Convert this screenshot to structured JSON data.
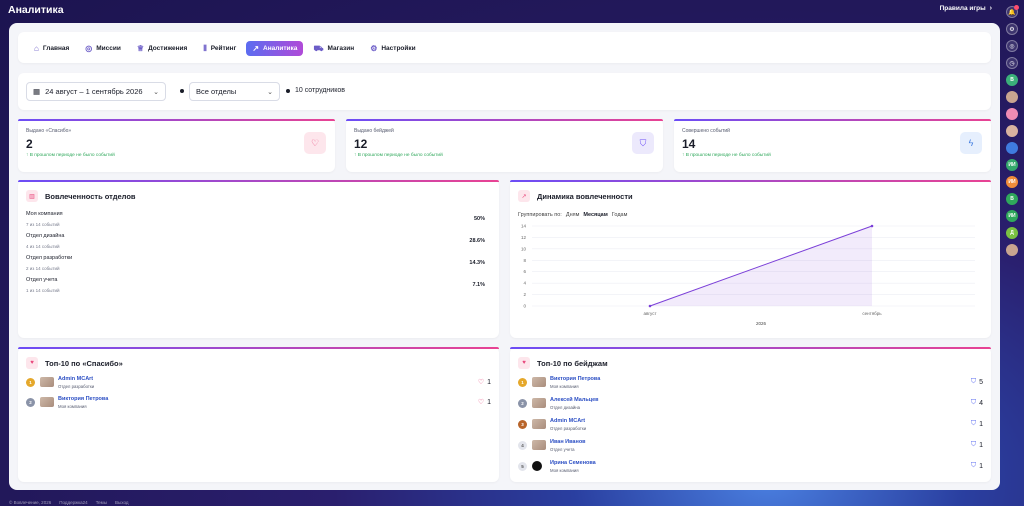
{
  "app": {
    "title": "Аналитика",
    "rules_link": "Правила игры"
  },
  "nav": {
    "tabs": [
      {
        "label": "Главная",
        "icon": "home-icon"
      },
      {
        "label": "Миссии",
        "icon": "target-icon"
      },
      {
        "label": "Достижения",
        "icon": "trophy-icon"
      },
      {
        "label": "Рейтинг",
        "icon": "podium-icon"
      },
      {
        "label": "Аналитика",
        "icon": "chart-icon",
        "active": true
      },
      {
        "label": "Магазин",
        "icon": "cart-icon"
      },
      {
        "label": "Настройки",
        "icon": "gear-icon"
      }
    ]
  },
  "filters": {
    "date_range": "24 август – 1 сентябрь 2026",
    "department": "Все отделы",
    "employees": "10 сотрудников"
  },
  "stats": [
    {
      "label": "Выдано «Спасибо»",
      "value": "2",
      "note": "В прошлом периоде не было событий",
      "icon": "heart-icon",
      "bg": "#fde6ec",
      "fg": "#e8457a"
    },
    {
      "label": "Выдано бейджей",
      "value": "12",
      "note": "В прошлом периоде не было событий",
      "icon": "shield-icon",
      "bg": "#ece9fc",
      "fg": "#6c4df6"
    },
    {
      "label": "Совершено событий",
      "value": "14",
      "note": "В прошлом периоде не было событий",
      "icon": "bolt-icon",
      "bg": "#e6effd",
      "fg": "#3f7be0"
    }
  ],
  "engagement": {
    "title": "Вовлеченность отделов",
    "rows": [
      {
        "name": "Моя компания",
        "sub": "7 из 14 событий",
        "pct": "50%"
      },
      {
        "name": "Отдел дизайна",
        "sub": "4 из 14 событий",
        "pct": "28.6%"
      },
      {
        "name": "Отдел разработки",
        "sub": "2 из 14 событий",
        "pct": "14.3%"
      },
      {
        "name": "Отдел учета",
        "sub": "1 из 14 событий",
        "pct": "7.1%"
      }
    ]
  },
  "dynamics": {
    "title": "Динамика вовлеченности",
    "group_label": "Группировать по:",
    "group_options": [
      "Дням",
      "Месяцам",
      "Годам"
    ],
    "active_option": "Месяцам"
  },
  "chart_data": {
    "type": "area",
    "categories": [
      "август",
      "сентябрь"
    ],
    "values": [
      0,
      14
    ],
    "xlabel": "2026",
    "ylabel": "",
    "ylim": [
      0,
      14
    ],
    "yticks": [
      0,
      2,
      4,
      6,
      8,
      10,
      12,
      14
    ],
    "grid": true,
    "color": "#7b3fd8"
  },
  "top_thanks": {
    "title": "Топ-10 по «Спасибо»",
    "rows": [
      {
        "rank": "1",
        "name": "Admin MCArt",
        "dept": "Отдел разработки",
        "count": "1",
        "rank_color": "#e5a82b"
      },
      {
        "rank": "2",
        "name": "Виктория Петрова",
        "dept": "Моя компания",
        "count": "1",
        "rank_color": "#8a93a8"
      }
    ]
  },
  "top_badges": {
    "title": "Топ-10 по бейджам",
    "rows": [
      {
        "rank": "1",
        "name": "Виктория Петрова",
        "dept": "Моя компания",
        "count": "5",
        "rank_color": "#e5a82b"
      },
      {
        "rank": "2",
        "name": "Алексей Мальцев",
        "dept": "Отдел дизайна",
        "count": "4",
        "rank_color": "#8a93a8"
      },
      {
        "rank": "3",
        "name": "Admin MCArt",
        "dept": "Отдел разработки",
        "count": "1",
        "rank_color": "#b8642a"
      },
      {
        "rank": "4",
        "name": "Иван Иванов",
        "dept": "Отдел учета",
        "count": "1",
        "rank_color": "#e3e5ec"
      },
      {
        "rank": "5",
        "name": "Ирина Семенова",
        "dept": "Моя компания",
        "count": "1",
        "rank_color": "#e3e5ec"
      }
    ]
  },
  "footer": {
    "items": [
      "© Вовлечение, 2026",
      "Поддержка24",
      "Темы",
      "Выход"
    ]
  }
}
